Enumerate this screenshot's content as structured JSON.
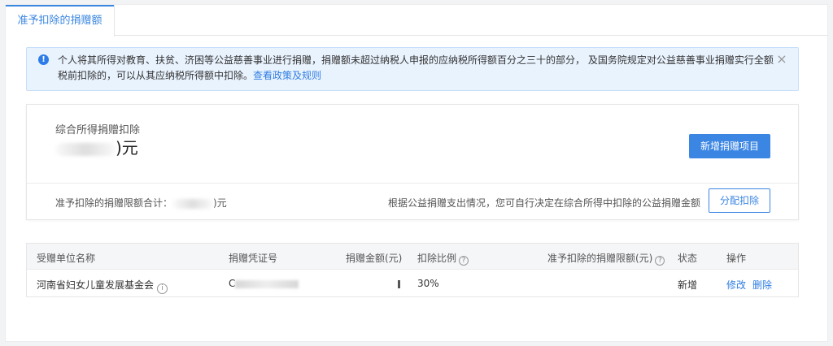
{
  "tabs": [
    {
      "label": "准予扣除的捐赠额"
    }
  ],
  "alert": {
    "text": "个人将其所得对教育、扶贫、济困等公益慈善事业进行捐赠，捐赠额未超过纳税人申报的应纳税所得额百分之三十的部分，  及国务院规定对公益慈善事业捐赠实行全额税前扣除的，可以从其应纳税所得额中扣除。",
    "link": "查看政策及规则"
  },
  "summary": {
    "label": "综合所得捐赠扣除",
    "amount_suffix": ")元",
    "add_button": "新增捐赠项目",
    "limit_label": "准予扣除的捐赠限额合计：",
    "limit_suffix": ")元",
    "hint": "根据公益捐赠支出情况，您可自行决定在综合所得中扣除的公益捐赠金额",
    "allocate_button": "分配扣除"
  },
  "table": {
    "headers": {
      "org": "受赠单位名称",
      "cert": "捐赠凭证号",
      "amount": "捐赠金额(元)",
      "ratio": "扣除比例",
      "limit": "准予扣除的捐赠限额(元)",
      "status": "状态",
      "action": "操作"
    },
    "rows": [
      {
        "org": "河南省妇女儿童发展基金会",
        "cert_prefix": "C",
        "ratio": "30%",
        "status": "新增",
        "edit": "修改",
        "delete": "删除"
      }
    ]
  },
  "icons": {
    "info": "info-icon",
    "close": "close-icon",
    "question": "question-icon",
    "org_info": "info-circle-icon"
  },
  "colors": {
    "primary": "#3b86e3",
    "alert_bg": "#e9f3fe",
    "page_bg": "#f2f3f5"
  }
}
